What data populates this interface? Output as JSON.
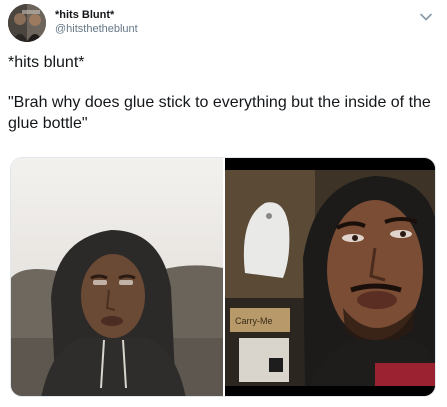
{
  "header": {
    "display_name": "*hits Blunt*",
    "handle": "@hitsthetheblunt"
  },
  "tweet": {
    "line1": "*hits blunt*",
    "line2": "\"Brah why does glue stick to everything but the inside of the glue bottle\""
  },
  "media": {
    "left_photo": "man-in-hoodie-photo",
    "right_photo": "man-in-hoodie-closeup-photo",
    "carry_me_text": "Carry-Me"
  },
  "icons": {
    "chevron": "chevron-down-icon"
  },
  "colors": {
    "handle_gray": "#657786",
    "text": "#14171a"
  }
}
